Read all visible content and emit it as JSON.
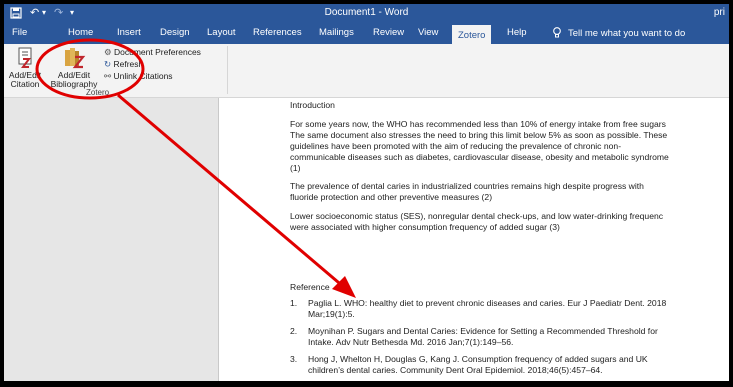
{
  "titlebar": {
    "title": "Document1  -  Word",
    "user": "pri",
    "save_icon": "save-icon",
    "undo_icon": "undo-icon",
    "redo_icon": "redo-icon",
    "qat_icon": "customize-quick-access-icon"
  },
  "tabs": [
    "File",
    "Home",
    "Insert",
    "Design",
    "Layout",
    "References",
    "Mailings",
    "Review",
    "View",
    "Zotero",
    "Help"
  ],
  "active_tab": "Zotero",
  "tell_me": "Tell me what you want to do",
  "ribbon": {
    "add_edit_citation": "Add/Edit Citation",
    "add_edit_citation_l1": "Add/Edit",
    "add_edit_citation_l2": "Citation",
    "add_edit_bibliography_l1": "Add/Edit",
    "add_edit_bibliography_l2": "Bibliography",
    "document_preferences": "Document Preferences",
    "refresh": "Refresh",
    "unlink_citations": "Unlink Citations",
    "group_label": "Zotero"
  },
  "document": {
    "heading": "Introduction",
    "p1": [
      "For some years now, the WHO has recommended less than 10% of energy intake from free sugars",
      "The same document also stresses the need to bring this limit below 5% as soon as possible. These",
      "guidelines have been promoted with the aim of reducing the prevalence of chronic non-",
      "communicable diseases such as diabetes, cardiovascular disease, obesity and metabolic syndrome",
      "(1)"
    ],
    "p2": [
      "The prevalence of dental caries in industrialized countries remains high despite progress with",
      "fluoride protection and other preventive measures (2)"
    ],
    "p3": [
      "Lower socioeconomic status (SES), nonregular dental check-ups, and low water-drinking frequenc",
      "were associated with higher consumption frequency of added sugar (3)"
    ],
    "reference_heading": "Reference",
    "references": [
      {
        "num": "1.",
        "lines": [
          "Paglia L. WHO: healthy diet to prevent chronic diseases and caries. Eur J Paediatr Dent. 2018",
          "Mar;19(1):5."
        ]
      },
      {
        "num": "2.",
        "lines": [
          "Moynihan P. Sugars and Dental Caries: Evidence for Setting a Recommended Threshold for",
          "Intake. Adv Nutr Bethesda Md. 2016 Jan;7(1):149–56."
        ]
      },
      {
        "num": "3.",
        "lines": [
          "Hong J, Whelton H, Douglas G, Kang J. Consumption frequency of added sugars and UK",
          "children’s dental caries. Community Dent Oral Epidemiol. 2018;46(5):457–64."
        ]
      }
    ]
  },
  "annotation": {
    "color": "#e00000",
    "shape": "circle-and-arrow"
  },
  "colors": {
    "word_blue": "#2b579a"
  }
}
